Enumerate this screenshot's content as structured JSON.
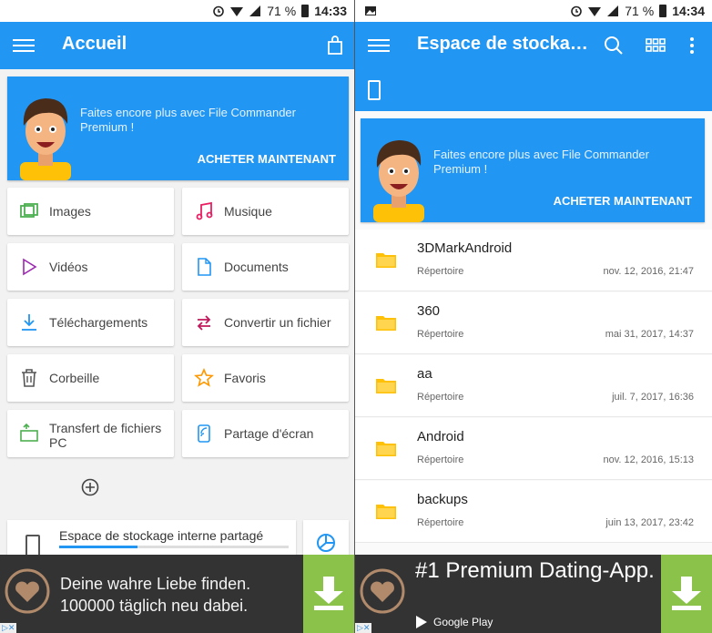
{
  "left": {
    "status": {
      "battery": "71 %",
      "time": "14:33"
    },
    "appbar": {
      "title": "Accueil"
    },
    "promo": {
      "text": "Faites encore plus avec File Commander Premium !",
      "button": "ACHETER MAINTENANT"
    },
    "categories": [
      {
        "label": "Images",
        "icon": "images-icon"
      },
      {
        "label": "Musique",
        "icon": "music-icon"
      },
      {
        "label": "Vidéos",
        "icon": "video-icon"
      },
      {
        "label": "Documents",
        "icon": "document-icon"
      },
      {
        "label": "Téléchargements",
        "icon": "download-icon"
      },
      {
        "label": "Convertir un fichier",
        "icon": "convert-icon"
      },
      {
        "label": "Corbeille",
        "icon": "trash-icon"
      },
      {
        "label": "Favoris",
        "icon": "star-icon"
      },
      {
        "label": "Transfert de fichiers PC",
        "icon": "pc-transfer-icon"
      },
      {
        "label": "Partage d'écran",
        "icon": "screen-share-icon"
      }
    ],
    "storage": {
      "label": "Espace de stockage interne partagé",
      "used_fraction": 0.34
    },
    "ad": {
      "line1": "Deine wahre Liebe finden.",
      "line2": "100000 täglich neu dabei."
    }
  },
  "right": {
    "status": {
      "battery": "71 %",
      "time": "14:34"
    },
    "appbar": {
      "title": "Espace de stockage..."
    },
    "promo": {
      "text": "Faites encore plus avec File Commander Premium !",
      "button": "ACHETER MAINTENANT"
    },
    "files": [
      {
        "name": "3DMarkAndroid",
        "type": "Répertoire",
        "date": "nov. 12, 2016, 21:47"
      },
      {
        "name": "360",
        "type": "Répertoire",
        "date": "mai 31, 2017, 14:37"
      },
      {
        "name": "aa",
        "type": "Répertoire",
        "date": "juil. 7, 2017, 16:36"
      },
      {
        "name": "Android",
        "type": "Répertoire",
        "date": "nov. 12, 2016, 15:13"
      },
      {
        "name": "backups",
        "type": "Répertoire",
        "date": "juin 13, 2017, 23:42"
      }
    ],
    "ad": {
      "headline": "#1 Premium Dating-App.",
      "store": "Google Play"
    }
  },
  "colors": {
    "primary": "#2196f3",
    "ad_bg": "#333333",
    "ad_button": "#8bc34a",
    "folder": "#ffc107"
  }
}
